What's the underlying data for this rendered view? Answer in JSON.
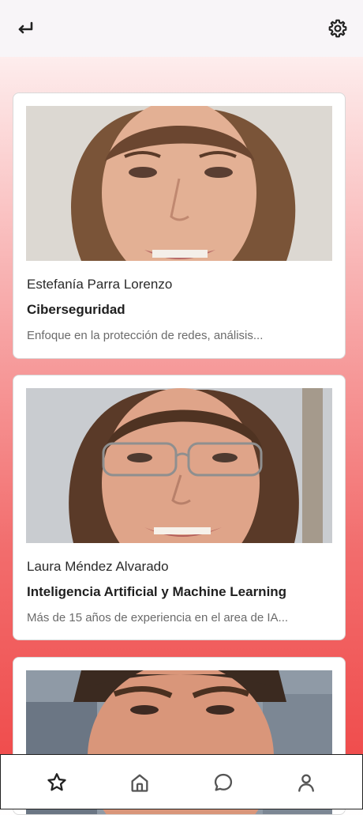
{
  "header": {
    "back_icon": "arrow-back-icon",
    "settings_icon": "gear-icon"
  },
  "cards": [
    {
      "name": "Estefanía Parra Lorenzo",
      "topic": "Ciberseguridad",
      "description": "Enfoque en la protección de redes, análisis..."
    },
    {
      "name": "Laura Méndez Alvarado",
      "topic": "Inteligencia Artificial y Machine Learning",
      "description": "Más de 15 años de experiencia  en el area de IA..."
    },
    {
      "name": "",
      "topic": "",
      "description": ""
    }
  ],
  "bottom_nav": {
    "items": [
      "star-icon",
      "home-icon",
      "chat-bubble-icon",
      "user-icon"
    ],
    "border_color": "#222222"
  },
  "colors": {
    "gradient_top": "#ffffff",
    "gradient_bottom": "#ef4545",
    "card_bg": "#ffffff",
    "text_primary": "#1f1f1f",
    "text_secondary": "#6b6b6b"
  }
}
